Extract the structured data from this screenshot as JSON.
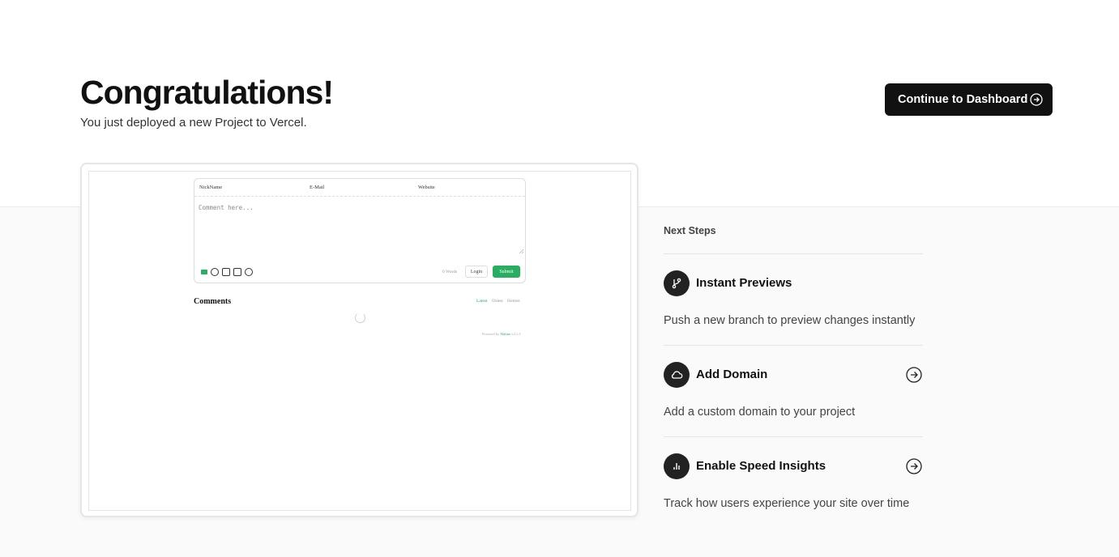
{
  "hero": {
    "title": "Congratulations!",
    "subtitle": "You just deployed a new Project to Vercel."
  },
  "cta": {
    "label": "Continue to Dashboard"
  },
  "preview": {
    "fields": [
      "NickName",
      "E-Mail",
      "Website"
    ],
    "comment_placeholder": "Comment here...",
    "word_count": "0 Words",
    "login_label": "Login",
    "submit_label": "Submit",
    "comments_heading": "Comments",
    "sort_options": [
      "Latest",
      "Oldest",
      "Hottest"
    ],
    "powered_by_prefix": "Powered by",
    "powered_by_brand": "Waline",
    "powered_by_version": "v3.1.3"
  },
  "next_steps": {
    "title": "Next Steps",
    "items": [
      {
        "title": "Instant Previews",
        "description": "Push a new branch to preview changes instantly",
        "icon": "git-branch-icon"
      },
      {
        "title": "Add Domain",
        "description": "Add a custom domain to your project",
        "icon": "cloud-icon"
      },
      {
        "title": "Enable Speed Insights",
        "description": "Track how users experience your site over time",
        "icon": "bar-chart-icon"
      }
    ]
  },
  "colors": {
    "primary": "#111111",
    "accent_green": "#27ae60",
    "muted_bg": "#fafafa"
  }
}
